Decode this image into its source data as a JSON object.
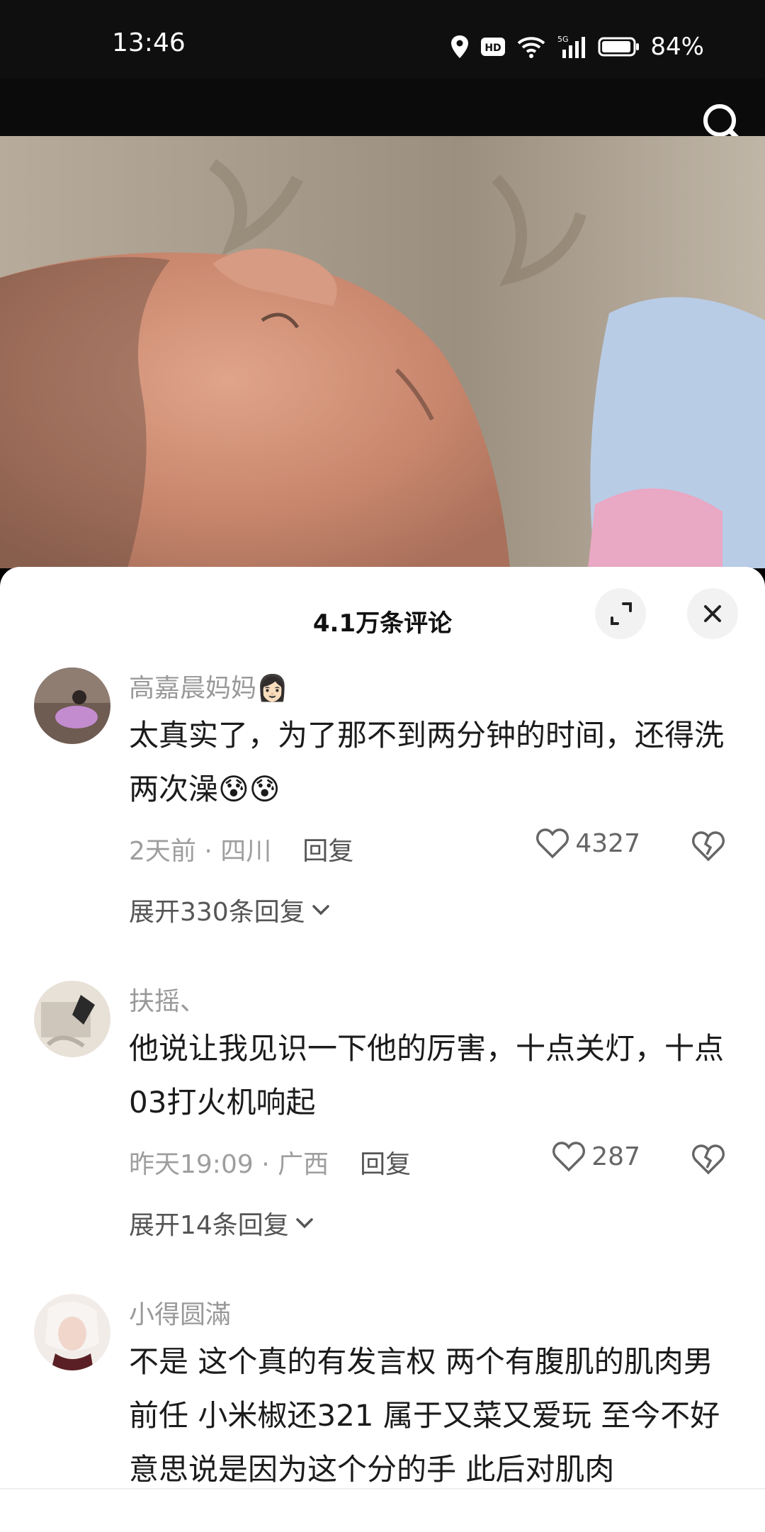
{
  "status_bar": {
    "time": "13:46",
    "battery": "84%"
  },
  "comments_panel": {
    "title": "4.1万条评论"
  },
  "comments": [
    {
      "username": "高嘉晨妈妈👩🏻",
      "text": "太真实了，为了那不到两分钟的时间，还得洗两次澡😰😰",
      "time_location": "2天前 · 四川",
      "reply_label": "回复",
      "likes": "4327",
      "expand_label": "展开330条回复"
    },
    {
      "username": "扶摇、",
      "text": "他说让我见识一下他的厉害，十点关灯，十点03打火机响起",
      "time_location": "昨天19:09 · 广西",
      "reply_label": "回复",
      "likes": "287",
      "expand_label": "展开14条回复"
    },
    {
      "username": "小得圆滿",
      "text": "不是 这个真的有发言权 两个有腹肌的肌肉男前任 小米椒还321 属于又菜又爱玩 至今不好意思说是因为这个分的手 此后对肌肉",
      "time_location": "",
      "reply_label": "",
      "likes": "",
      "expand_label": ""
    }
  ],
  "icons": {
    "search": "search-icon",
    "fullscreen": "expand-icon",
    "close": "close-icon",
    "like": "heart-icon",
    "dislike": "broken-heart-icon",
    "chevron": "chevron-down-icon"
  }
}
